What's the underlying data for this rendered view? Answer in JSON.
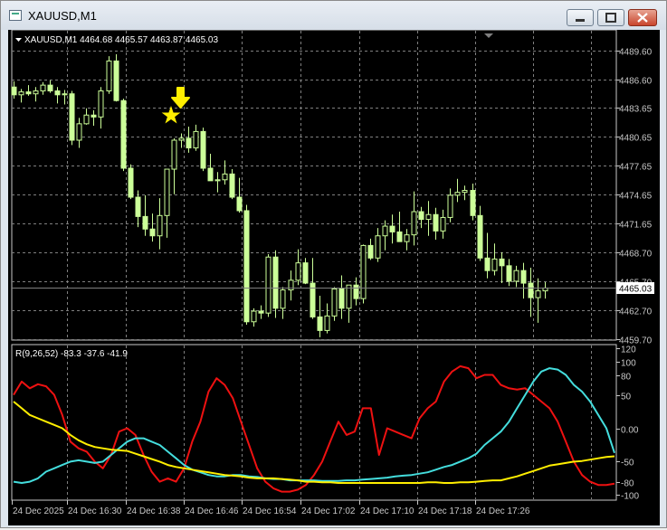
{
  "window": {
    "title": "XAUUSD,M1",
    "min_icon": "minimize-icon",
    "max_icon": "maximize-icon",
    "close_icon": "close-icon"
  },
  "price_panel": {
    "header": "XAUUSD,M1  4464.68 4465.57 4463.87 4465.03",
    "current_price": "4465.03",
    "price_axis_labels": [
      "4489.60",
      "4486.60",
      "4483.65",
      "4480.65",
      "4477.65",
      "4474.65",
      "4471.65",
      "4468.70",
      "4465.70",
      "4462.70",
      "4459.70"
    ],
    "arrow_marker": "down-arrow-icon",
    "star_marker": "star-icon",
    "colors": {
      "background": "#000000",
      "grid": "#7f7f7f",
      "candle": "#ccff99",
      "marker": "#ffee00",
      "current_line": "#7f7f7f"
    }
  },
  "indicator_panel": {
    "header": "R(9,26,52) -83.3 -37.6 -41.9",
    "axis_labels": [
      "120",
      "100",
      "80",
      "50",
      "0.00",
      "-50",
      "-80",
      "-100"
    ],
    "colors": {
      "red": "#ee1111",
      "cyan": "#44dddd",
      "yellow": "#ffee00"
    }
  },
  "time_axis": [
    "24 Dec 2025",
    "24 Dec 16:30",
    "24 Dec 16:38",
    "24 Dec 16:46",
    "24 Dec 16:54",
    "24 Dec 17:02",
    "24 Dec 17:10",
    "24 Dec 17:18",
    "24 Dec 17:26"
  ],
  "chart_data": [
    {
      "type": "candlestick",
      "title": "XAUUSD,M1",
      "ylim": [
        4459.7,
        4490.6
      ],
      "candles": [
        [
          4485.8,
          4486.4,
          4484.6,
          4485.0
        ],
        [
          4485.0,
          4485.6,
          4484.2,
          4485.3
        ],
        [
          4485.3,
          4486.0,
          4484.9,
          4485.1
        ],
        [
          4485.1,
          4485.8,
          4484.3,
          4485.4
        ],
        [
          4485.4,
          4486.3,
          4485.0,
          4486.0
        ],
        [
          4486.0,
          4486.5,
          4485.2,
          4485.4
        ],
        [
          4485.4,
          4485.8,
          4484.1,
          4485.0
        ],
        [
          4485.0,
          4485.5,
          4484.0,
          4485.1
        ],
        [
          4485.1,
          4485.4,
          4479.8,
          4480.3
        ],
        [
          4480.3,
          4482.6,
          4479.5,
          4482.0
        ],
        [
          4482.0,
          4483.6,
          4481.9,
          4482.9
        ],
        [
          4482.9,
          4483.4,
          4481.8,
          4482.7
        ],
        [
          4482.7,
          4485.8,
          4481.5,
          4485.4
        ],
        [
          4485.4,
          4489.0,
          4485.1,
          4488.5
        ],
        [
          4488.5,
          4489.2,
          4484.3,
          4484.4
        ],
        [
          4484.4,
          4484.6,
          4477.1,
          4477.4
        ],
        [
          4477.4,
          4477.8,
          4474.2,
          4474.4
        ],
        [
          4474.4,
          4475.1,
          4471.3,
          4472.4
        ],
        [
          4472.4,
          4474.6,
          4470.4,
          4471.1
        ],
        [
          4471.1,
          4472.7,
          4469.8,
          4470.4
        ],
        [
          4470.4,
          4474.3,
          4469.0,
          4472.5
        ],
        [
          4472.5,
          4474.8,
          4470.2,
          4477.3
        ],
        [
          4477.3,
          4480.5,
          4474.7,
          4480.3
        ],
        [
          4480.3,
          4481.0,
          4479.5,
          4480.5
        ],
        [
          4480.5,
          4481.7,
          4479.0,
          4479.5
        ],
        [
          4479.5,
          4481.9,
          4479.2,
          4481.2
        ],
        [
          4481.2,
          4481.6,
          4477.1,
          4477.4
        ],
        [
          4477.4,
          4478.9,
          4476.2,
          4476.1
        ],
        [
          4476.1,
          4477.0,
          4474.9,
          4476.2
        ],
        [
          4476.2,
          4478.2,
          4475.7,
          4476.8
        ],
        [
          4476.8,
          4477.3,
          4474.2,
          4474.4
        ],
        [
          4474.4,
          4476.4,
          4472.8,
          4473.0
        ],
        [
          4473.0,
          4473.6,
          4461.2,
          4461.5
        ],
        [
          4461.5,
          4462.9,
          4461.0,
          4462.6
        ],
        [
          4462.6,
          4463.2,
          4461.8,
          4462.4
        ],
        [
          4462.4,
          4468.5,
          4462.0,
          4468.2
        ],
        [
          4468.2,
          4468.9,
          4461.9,
          4462.9
        ],
        [
          4462.9,
          4465.1,
          4461.8,
          4464.8
        ],
        [
          4464.8,
          4466.8,
          4463.7,
          4465.8
        ],
        [
          4465.8,
          4469.0,
          4465.3,
          4467.6
        ],
        [
          4467.6,
          4468.1,
          4465.4,
          4465.5
        ],
        [
          4465.5,
          4468.1,
          4461.8,
          4462.0
        ],
        [
          4462.0,
          4464.2,
          4459.9,
          4460.6
        ],
        [
          4460.6,
          4463.4,
          4460.3,
          4462.1
        ],
        [
          4462.1,
          4465.1,
          4461.6,
          4464.9
        ],
        [
          4464.9,
          4466.3,
          4461.8,
          4462.9
        ],
        [
          4462.9,
          4465.2,
          4461.4,
          4465.3
        ],
        [
          4465.3,
          4466.1,
          4463.2,
          4463.9
        ],
        [
          4463.9,
          4469.5,
          4463.4,
          4469.4
        ],
        [
          4469.4,
          4470.1,
          4467.9,
          4468.1
        ],
        [
          4468.1,
          4471.2,
          4467.7,
          4470.4
        ],
        [
          4470.4,
          4472.0,
          4468.9,
          4471.4
        ],
        [
          4471.4,
          4472.6,
          4469.6,
          4470.8
        ],
        [
          4470.8,
          4472.9,
          4470.0,
          4469.8
        ],
        [
          4469.8,
          4471.1,
          4468.9,
          4470.5
        ],
        [
          4470.5,
          4475.0,
          4469.4,
          4472.9
        ],
        [
          4472.9,
          4473.4,
          4471.2,
          4472.1
        ],
        [
          4472.1,
          4474.0,
          4470.4,
          4472.6
        ],
        [
          4472.6,
          4473.3,
          4470.0,
          4470.9
        ],
        [
          4470.9,
          4473.1,
          4470.1,
          4472.3
        ],
        [
          4472.3,
          4475.3,
          4471.8,
          4474.6
        ],
        [
          4474.6,
          4476.3,
          4473.9,
          4474.9
        ],
        [
          4474.9,
          4475.6,
          4474.1,
          4475.1
        ],
        [
          4475.1,
          4475.8,
          4472.0,
          4472.5
        ],
        [
          4472.5,
          4473.5,
          4467.8,
          4468.1
        ],
        [
          4468.1,
          4470.7,
          4466.0,
          4466.8
        ],
        [
          4466.8,
          4469.6,
          4466.3,
          4468.0
        ],
        [
          4468.0,
          4468.7,
          4465.5,
          4467.3
        ],
        [
          4467.3,
          4468.0,
          4465.2,
          4465.7
        ],
        [
          4465.7,
          4467.3,
          4465.1,
          4466.8
        ],
        [
          4466.8,
          4467.6,
          4463.9,
          4465.5
        ],
        [
          4465.5,
          4467.1,
          4462.0,
          4464.0
        ],
        [
          4464.0,
          4466.0,
          4461.4,
          4464.7
        ],
        [
          4464.7,
          4465.6,
          4463.9,
          4465.0
        ]
      ]
    },
    {
      "type": "line",
      "title": "R(9,26,52)",
      "ylim": [
        -105,
        120
      ],
      "series": [
        {
          "color": "#ee1111",
          "values": [
            50,
            70,
            60,
            66,
            63,
            50,
            20,
            -20,
            -30,
            -35,
            -50,
            -60,
            -40,
            -5,
            0,
            -10,
            -40,
            -65,
            -80,
            -75,
            -80,
            -60,
            -20,
            10,
            55,
            75,
            65,
            45,
            10,
            -25,
            -60,
            -80,
            -90,
            -95,
            -95,
            -92,
            -85,
            -70,
            -50,
            -20,
            10,
            -10,
            -5,
            30,
            30,
            -40,
            0,
            -5,
            -10,
            -15,
            15,
            30,
            40,
            70,
            85,
            93,
            90,
            75,
            80,
            80,
            65,
            60,
            58,
            60,
            50,
            40,
            30,
            10,
            -20,
            -50,
            -70,
            -80,
            -85,
            -85,
            -83
          ]
        },
        {
          "color": "#44dddd",
          "values": [
            -80,
            -82,
            -80,
            -75,
            -65,
            -60,
            -55,
            -50,
            -48,
            -50,
            -52,
            -50,
            -40,
            -30,
            -20,
            -15,
            -15,
            -20,
            -25,
            -35,
            -45,
            -55,
            -62,
            -66,
            -70,
            -72,
            -72,
            -70,
            -70,
            -72,
            -73,
            -75,
            -76,
            -76,
            -78,
            -78,
            -78,
            -78,
            -79,
            -79,
            -79,
            -78,
            -78,
            -77,
            -76,
            -75,
            -74,
            -72,
            -71,
            -70,
            -68,
            -66,
            -62,
            -58,
            -55,
            -50,
            -45,
            -38,
            -25,
            -15,
            -5,
            10,
            30,
            50,
            70,
            85,
            90,
            88,
            80,
            65,
            55,
            40,
            20,
            0,
            -37
          ]
        },
        {
          "color": "#ffee00",
          "values": [
            40,
            30,
            20,
            15,
            10,
            5,
            0,
            -10,
            -18,
            -24,
            -28,
            -30,
            -32,
            -33,
            -34,
            -38,
            -42,
            -46,
            -50,
            -55,
            -58,
            -60,
            -62,
            -64,
            -66,
            -68,
            -70,
            -71,
            -72,
            -74,
            -75,
            -75,
            -75,
            -76,
            -77,
            -78,
            -80,
            -80,
            -81,
            -81,
            -82,
            -82,
            -82,
            -82,
            -82,
            -82,
            -82,
            -82,
            -82,
            -82,
            -82,
            -81,
            -81,
            -82,
            -82,
            -81,
            -81,
            -80,
            -79,
            -78,
            -78,
            -75,
            -72,
            -68,
            -64,
            -60,
            -56,
            -54,
            -52,
            -50,
            -49,
            -47,
            -45,
            -43,
            -42
          ]
        }
      ]
    }
  ]
}
